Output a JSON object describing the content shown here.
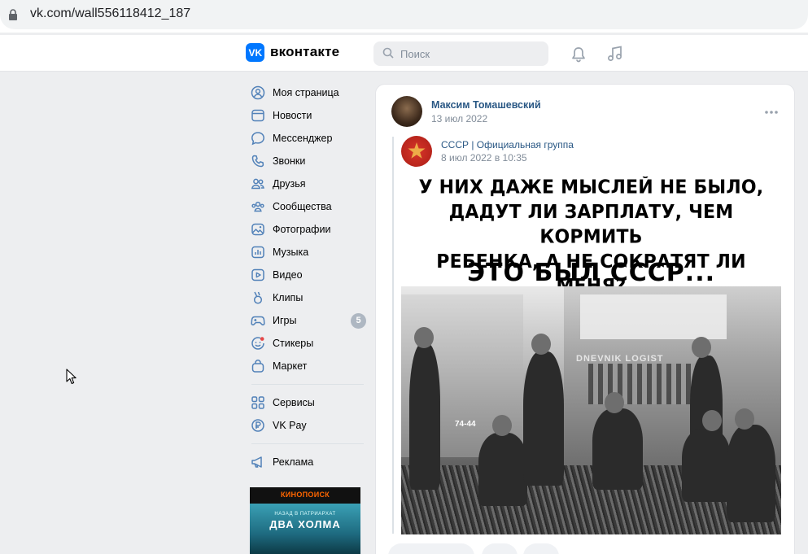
{
  "browser": {
    "url": "vk.com/wall556118412_187"
  },
  "header": {
    "logo_text": "вконтакте",
    "search_placeholder": "Поиск",
    "brand_color": "#0077ff"
  },
  "sidebar": {
    "items": [
      {
        "label": "Моя страница",
        "icon": "user-circle-icon"
      },
      {
        "label": "Новости",
        "icon": "news-icon"
      },
      {
        "label": "Мессенджер",
        "icon": "message-icon"
      },
      {
        "label": "Звонки",
        "icon": "phone-icon"
      },
      {
        "label": "Друзья",
        "icon": "friends-icon"
      },
      {
        "label": "Сообщества",
        "icon": "communities-icon"
      },
      {
        "label": "Фотографии",
        "icon": "photo-icon"
      },
      {
        "label": "Музыка",
        "icon": "music-icon"
      },
      {
        "label": "Видео",
        "icon": "video-icon"
      },
      {
        "label": "Клипы",
        "icon": "clips-icon"
      },
      {
        "label": "Игры",
        "icon": "games-icon",
        "badge": "5"
      },
      {
        "label": "Стикеры",
        "icon": "stickers-icon"
      },
      {
        "label": "Маркет",
        "icon": "market-icon"
      }
    ],
    "items2": [
      {
        "label": "Сервисы",
        "icon": "services-icon"
      },
      {
        "label": "VK Pay",
        "icon": "vkpay-icon"
      }
    ],
    "items3": [
      {
        "label": "Реклама",
        "icon": "ads-icon"
      }
    ],
    "promo": {
      "brand": "КИНОПОИСК",
      "subtitle": "НАЗАД В ПАТРИАРХАТ",
      "title": "ДВА ХОЛМА"
    }
  },
  "post": {
    "author": "Максим Томашевский",
    "date": "13 июл 2022",
    "repost": {
      "group_name": "СССР | Официальная группа",
      "date": "8 июл 2022 в 10:35"
    },
    "image": {
      "caption_lines": [
        "У НИХ ДАЖЕ МЫСЛЕЙ НЕ БЫЛО,",
        "ДАДУТ ЛИ ЗАРПЛАТУ, ЧЕМ КОРМИТЬ",
        "РЕБЕНКА, А НЕ СОКРАТЯТ ЛИ МЕНЯ?"
      ],
      "caption_big": "ЭТО БЫЛ СССР...",
      "truck_label": "DNEVNIK LOGIST",
      "plate": "74-44"
    }
  }
}
